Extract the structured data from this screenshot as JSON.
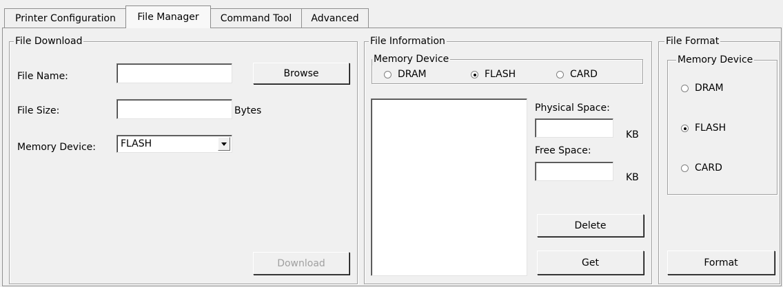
{
  "tabs": [
    {
      "label": "Printer Configuration",
      "active": false
    },
    {
      "label": "File Manager",
      "active": true
    },
    {
      "label": "Command Tool",
      "active": false
    },
    {
      "label": "Advanced",
      "active": false
    }
  ],
  "file_download": {
    "title": "File Download",
    "file_name_label": "File Name:",
    "file_name_value": "",
    "browse_label": "Browse",
    "file_size_label": "File Size:",
    "file_size_value": "",
    "bytes_label": "Bytes",
    "memory_device_label": "Memory Device:",
    "memory_device_value": "FLASH",
    "download_label": "Download",
    "download_enabled": false
  },
  "file_information": {
    "title": "File Information",
    "memory_device_title": "Memory Device",
    "radios": [
      {
        "label": "DRAM",
        "checked": false
      },
      {
        "label": "FLASH",
        "checked": true
      },
      {
        "label": "CARD",
        "checked": false
      }
    ],
    "file_list": [],
    "physical_space_label": "Physical Space:",
    "physical_space_value": "",
    "physical_space_unit": "KB",
    "free_space_label": "Free Space:",
    "free_space_value": "",
    "free_space_unit": "KB",
    "delete_label": "Delete",
    "get_label": "Get"
  },
  "file_format": {
    "title": "File Format",
    "memory_device_title": "Memory Device",
    "radios": [
      {
        "label": "DRAM",
        "checked": false
      },
      {
        "label": "FLASH",
        "checked": true
      },
      {
        "label": "CARD",
        "checked": false
      }
    ],
    "format_label": "Format"
  }
}
